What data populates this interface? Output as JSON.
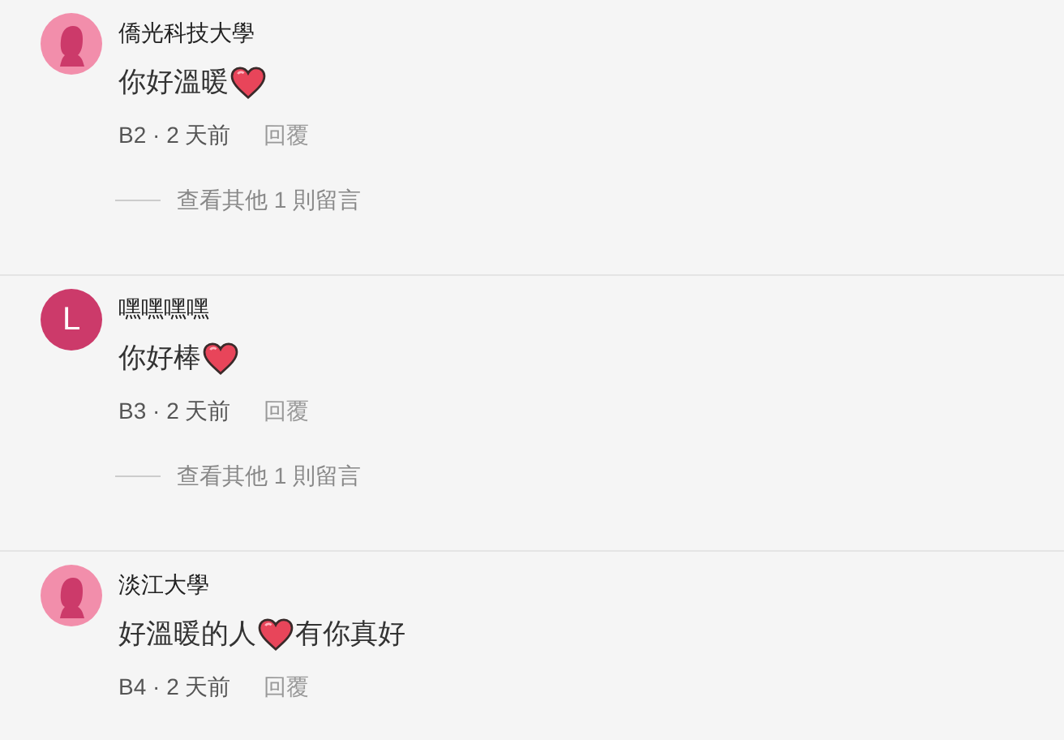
{
  "comments": [
    {
      "author": "僑光科技大學",
      "avatar": {
        "kind": "silhouette"
      },
      "body": [
        {
          "kind": "text",
          "text": "你好溫暖"
        },
        {
          "kind": "heart"
        }
      ],
      "floor": "B2",
      "time": "· 2 天前",
      "reply": "回覆",
      "more_replies": "查看其他 1 則留言"
    },
    {
      "author": "嘿嘿嘿嘿",
      "avatar": {
        "kind": "letter",
        "letter": "L"
      },
      "body": [
        {
          "kind": "text",
          "text": "你好棒"
        },
        {
          "kind": "heart"
        }
      ],
      "floor": "B3",
      "time": "· 2 天前",
      "reply": "回覆",
      "more_replies": "查看其他 1 則留言"
    },
    {
      "author": "淡江大學",
      "avatar": {
        "kind": "silhouette"
      },
      "body": [
        {
          "kind": "text",
          "text": "好溫暖的人"
        },
        {
          "kind": "heart"
        },
        {
          "kind": "text",
          "text": "有你真好"
        }
      ],
      "floor": "B4",
      "time": "· 2 天前",
      "reply": "回覆"
    }
  ]
}
